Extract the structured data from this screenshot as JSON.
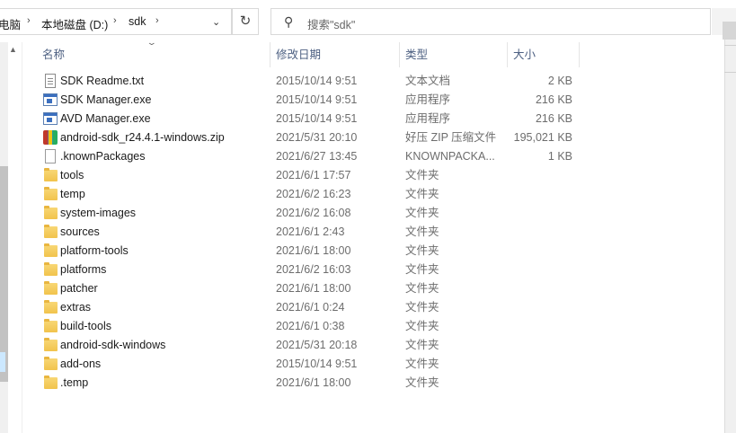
{
  "address": {
    "crumbs": [
      "电脑",
      "本地磁盘 (D:)",
      "sdk"
    ],
    "separator": "›",
    "dropdown_glyph": "⌄",
    "refresh_glyph": "↻"
  },
  "search": {
    "placeholder": "搜索\"sdk\"",
    "icon": "⚲"
  },
  "columns": {
    "name": "名称",
    "date": "修改日期",
    "type": "类型",
    "size": "大小"
  },
  "icons": {
    "sort_chevron": "⌄",
    "scroll_up": "▲"
  },
  "files": [
    {
      "name": "SDK Readme.txt",
      "date": "2015/10/14 9:51",
      "type": "文本文档",
      "size": "2 KB",
      "icon": "text-file-icon"
    },
    {
      "name": "SDK Manager.exe",
      "date": "2015/10/14 9:51",
      "type": "应用程序",
      "size": "216 KB",
      "icon": "exe-file-icon"
    },
    {
      "name": "AVD Manager.exe",
      "date": "2015/10/14 9:51",
      "type": "应用程序",
      "size": "216 KB",
      "icon": "exe-file-icon"
    },
    {
      "name": "android-sdk_r24.4.1-windows.zip",
      "date": "2021/5/31 20:10",
      "type": "好压 ZIP 压缩文件",
      "size": "195,021 KB",
      "icon": "zip-file-icon"
    },
    {
      "name": ".knownPackages",
      "date": "2021/6/27 13:45",
      "type": "KNOWNPACKA...",
      "size": "1 KB",
      "icon": "blank-file-icon"
    },
    {
      "name": "tools",
      "date": "2021/6/1 17:57",
      "type": "文件夹",
      "size": "",
      "icon": "folder-icon"
    },
    {
      "name": "temp",
      "date": "2021/6/2 16:23",
      "type": "文件夹",
      "size": "",
      "icon": "folder-icon"
    },
    {
      "name": "system-images",
      "date": "2021/6/2 16:08",
      "type": "文件夹",
      "size": "",
      "icon": "folder-icon"
    },
    {
      "name": "sources",
      "date": "2021/6/1 2:43",
      "type": "文件夹",
      "size": "",
      "icon": "folder-icon"
    },
    {
      "name": "platform-tools",
      "date": "2021/6/1 18:00",
      "type": "文件夹",
      "size": "",
      "icon": "folder-icon"
    },
    {
      "name": "platforms",
      "date": "2021/6/2 16:03",
      "type": "文件夹",
      "size": "",
      "icon": "folder-icon"
    },
    {
      "name": "patcher",
      "date": "2021/6/1 18:00",
      "type": "文件夹",
      "size": "",
      "icon": "folder-icon"
    },
    {
      "name": "extras",
      "date": "2021/6/1 0:24",
      "type": "文件夹",
      "size": "",
      "icon": "folder-icon"
    },
    {
      "name": "build-tools",
      "date": "2021/6/1 0:38",
      "type": "文件夹",
      "size": "",
      "icon": "folder-icon"
    },
    {
      "name": "android-sdk-windows",
      "date": "2021/5/31 20:18",
      "type": "文件夹",
      "size": "",
      "icon": "folder-icon"
    },
    {
      "name": "add-ons",
      "date": "2015/10/14 9:51",
      "type": "文件夹",
      "size": "",
      "icon": "folder-icon"
    },
    {
      "name": ".temp",
      "date": "2021/6/1 18:00",
      "type": "文件夹",
      "size": "",
      "icon": "folder-icon"
    }
  ]
}
